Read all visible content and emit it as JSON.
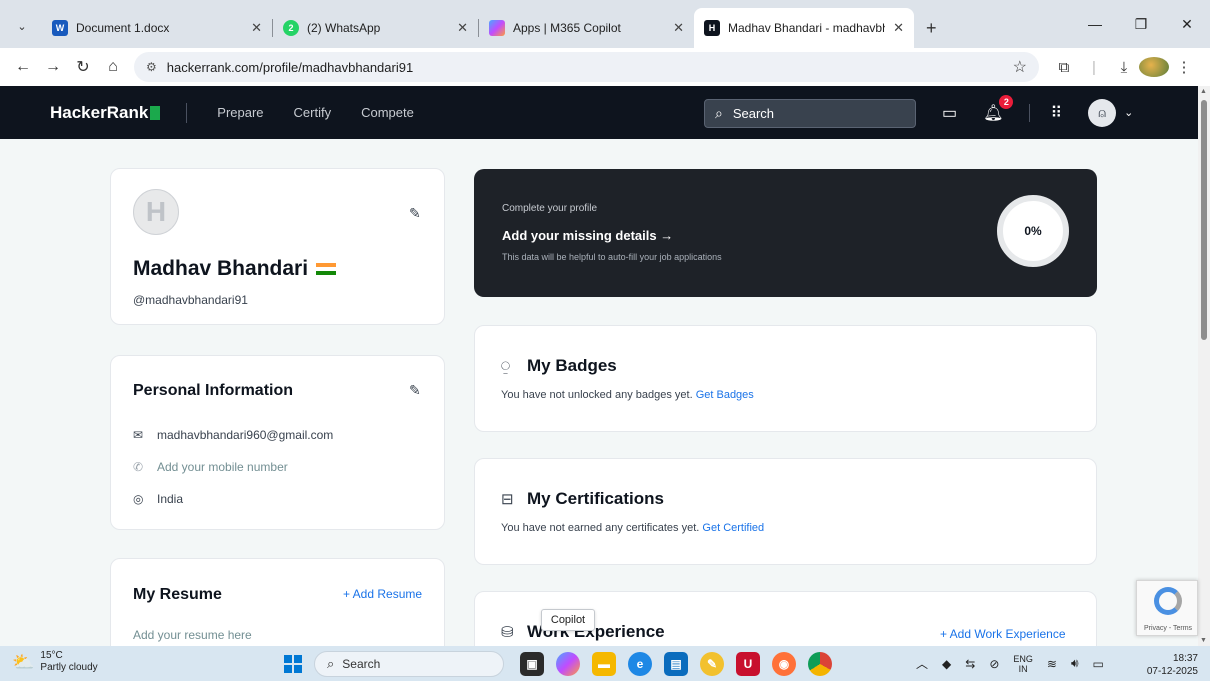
{
  "browser": {
    "tabs": [
      {
        "title": "Document 1.docx",
        "favicon": "word-icon",
        "color": "#185abd"
      },
      {
        "title": "(2) WhatsApp",
        "favicon": "whatsapp-icon",
        "color": "#25d366",
        "badge": "2"
      },
      {
        "title": "Apps | M365 Copilot",
        "favicon": "copilot-icon",
        "color": "#7b5cf0"
      },
      {
        "title": "Madhav Bhandari - madhavbha",
        "favicon": "hackerrank-icon",
        "color": "#0e141e",
        "favicon_text": "H"
      }
    ],
    "url": "hackerrank.com/profile/madhavbhandari91"
  },
  "hackerrank": {
    "logo": "HackerRank",
    "nav": [
      "Prepare",
      "Certify",
      "Compete"
    ],
    "search_label": "Search",
    "notification_count": "2"
  },
  "profile": {
    "avatar_letter": "H",
    "name": "Madhav Bhandari",
    "handle": "@madhavbhandari91"
  },
  "personal_info": {
    "title": "Personal Information",
    "email": "madhavbhandari960@gmail.com",
    "phone_placeholder": "Add your mobile number",
    "country": "India"
  },
  "resume": {
    "title": "My Resume",
    "add_label": "+ Add Resume",
    "hint": "Add your resume here"
  },
  "complete_profile": {
    "label": "Complete your profile",
    "title": "Add your missing details →",
    "description": "This data will be helpful to auto-fill your job applications",
    "percent": "0%"
  },
  "badges": {
    "title": "My Badges",
    "text": "You have not unlocked any badges yet.",
    "link": "Get Badges"
  },
  "certifications": {
    "title": "My Certifications",
    "text": "You have not earned any certificates yet.",
    "link": "Get Certified"
  },
  "work": {
    "title": "Work Experience",
    "add_label": "+ Add Work Experience"
  },
  "tooltip": "Copilot",
  "recaptcha_text": "Privacy - Terms",
  "taskbar": {
    "temperature": "15°C",
    "weather": "Partly cloudy",
    "search": "Search",
    "lang_top": "ENG",
    "lang_bottom": "IN",
    "time": "18:37",
    "date": "07-12-2025"
  }
}
